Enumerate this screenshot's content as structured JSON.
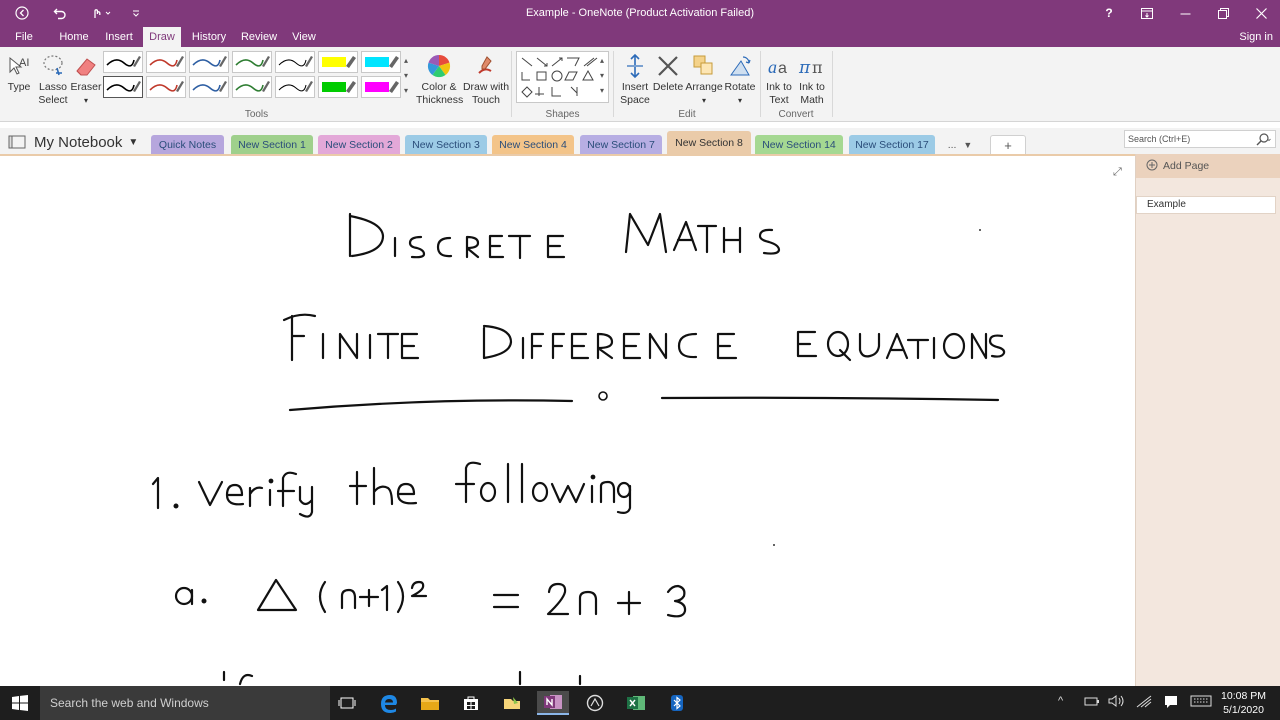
{
  "title_bar": {
    "title": "Example - OneNote (Product Activation Failed)",
    "help": "?"
  },
  "ribbon_tabs": {
    "file": "File",
    "home": "Home",
    "insert": "Insert",
    "draw": "Draw",
    "history": "History",
    "review": "Review",
    "view": "View",
    "sign_in": "Sign in"
  },
  "ribbon": {
    "type": "Type",
    "lasso_1": "Lasso",
    "lasso_2": "Select",
    "eraser": "Eraser",
    "color_1": "Color &",
    "color_2": "Thickness",
    "touch_1": "Draw with",
    "touch_2": "Touch",
    "insert_space_1": "Insert",
    "insert_space_2": "Space",
    "delete": "Delete",
    "arrange": "Arrange",
    "rotate": "Rotate",
    "ink_text_1": "Ink to",
    "ink_text_2": "Text",
    "ink_math_1": "Ink to",
    "ink_math_2": "Math",
    "group_tools": "Tools",
    "group_shapes": "Shapes",
    "group_edit": "Edit",
    "group_convert": "Convert",
    "pen_colors": [
      "#000000",
      "#c0392b",
      "#2e5fa3",
      "#2e7d32",
      "#000000",
      "#ffff00",
      "#00e5ff",
      "#000000",
      "#c0392b",
      "#2e5fa3",
      "#2e7d32",
      "#000000",
      "#00cc00",
      "#ff00ff"
    ]
  },
  "notebook": {
    "name": "My Notebook"
  },
  "sections": [
    {
      "label": "Quick Notes",
      "color": "#b6a6dd"
    },
    {
      "label": "New Section 1",
      "color": "#9fd08c"
    },
    {
      "label": "New Section 2",
      "color": "#e3a8d8"
    },
    {
      "label": "New Section 3",
      "color": "#9ccbe6"
    },
    {
      "label": "New Section 4",
      "color": "#f3c489"
    },
    {
      "label": "New Section 7",
      "color": "#b7aee3"
    },
    {
      "label": "New Section 8",
      "color": "#eacba9"
    },
    {
      "label": "New Section 14",
      "color": "#a5d892"
    },
    {
      "label": "New Section 17",
      "color": "#9ccbe6"
    }
  ],
  "section_overflow": "...",
  "search": {
    "placeholder": "Search (Ctrl+E)"
  },
  "page_pane": {
    "add_page": "Add Page",
    "pages": [
      "Example"
    ]
  },
  "taskbar": {
    "search_placeholder": "Search the web and Windows",
    "time": "10:08 PM",
    "date": "5/1/2020"
  },
  "colors": {
    "accent": "#80397b",
    "ribbon_bg": "#f3f3f3",
    "page_pane_bg": "#f3e7de"
  }
}
